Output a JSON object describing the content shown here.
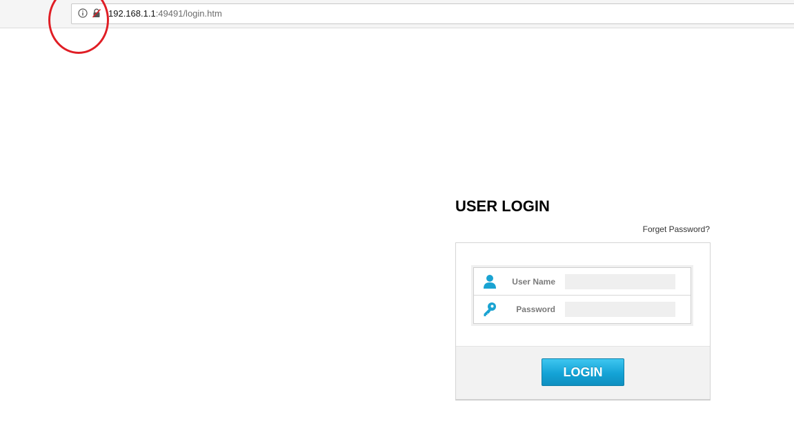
{
  "browser": {
    "url_host": "192.168.1.1",
    "url_rest": ":49491/login.htm"
  },
  "login": {
    "title": "USER LOGIN",
    "forget_password": "Forget Password?",
    "username_label": "User Name",
    "password_label": "Password",
    "username_value": "",
    "password_value": "",
    "login_button": "LOGIN"
  },
  "colors": {
    "accent": "#14a3d6",
    "icon": "#1aa3d2",
    "annotation": "#e01e25"
  },
  "icons": {
    "site_info": "info-icon",
    "not_secure": "insecure-lock-icon",
    "username": "user-icon",
    "password": "key-icon"
  }
}
